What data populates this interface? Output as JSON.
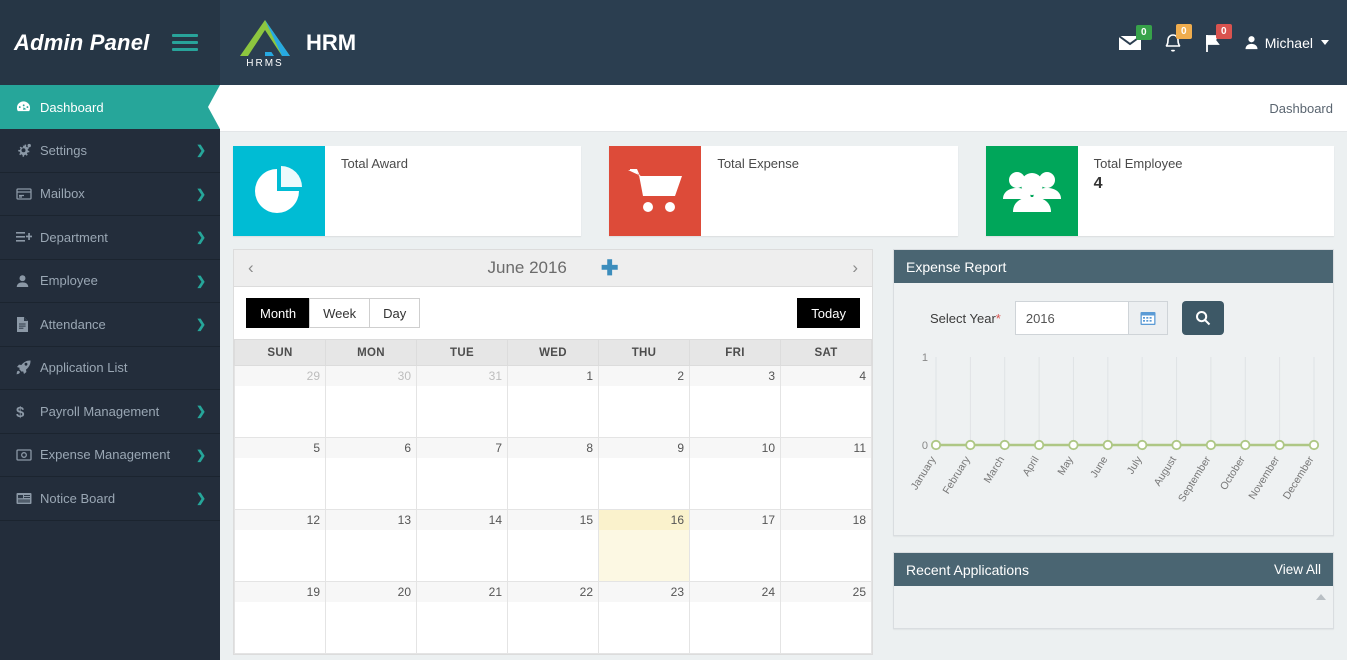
{
  "brand": {
    "title": "Admin Panel",
    "menu_icon": "hamburger-icon"
  },
  "header": {
    "logo_text": "HRMS",
    "app_title": "HRM",
    "notifications": [
      {
        "icon": "envelope-icon",
        "count": "0",
        "color": "#37a24a"
      },
      {
        "icon": "bell-icon",
        "count": "0",
        "color": "#f0ad4e"
      },
      {
        "icon": "flag-icon",
        "count": "0",
        "color": "#d9534f"
      }
    ],
    "user": "Michael"
  },
  "breadcrumb": {
    "current": "Dashboard"
  },
  "sidebar": {
    "items": [
      {
        "label": "Dashboard",
        "icon": "dashboard-icon",
        "active": true,
        "arrow": false
      },
      {
        "label": "Settings",
        "icon": "gears-icon",
        "active": false,
        "arrow": true
      },
      {
        "label": "Mailbox",
        "icon": "mailbox-icon",
        "active": false,
        "arrow": true
      },
      {
        "label": "Department",
        "icon": "department-icon",
        "active": false,
        "arrow": true
      },
      {
        "label": "Employee",
        "icon": "user-icon",
        "active": false,
        "arrow": true
      },
      {
        "label": "Attendance",
        "icon": "file-icon",
        "active": false,
        "arrow": true
      },
      {
        "label": "Application List",
        "icon": "rocket-icon",
        "active": false,
        "arrow": false
      },
      {
        "label": "Payroll Management",
        "icon": "dollar-icon",
        "active": false,
        "arrow": true
      },
      {
        "label": "Expense Management",
        "icon": "money-icon",
        "active": false,
        "arrow": true
      },
      {
        "label": "Notice Board",
        "icon": "board-icon",
        "active": false,
        "arrow": true
      }
    ]
  },
  "cards": [
    {
      "label": "Total Award",
      "value": "",
      "icon": "pie-chart-icon",
      "color": "#00bcd4"
    },
    {
      "label": "Total Expense",
      "value": "",
      "icon": "shopping-cart-icon",
      "color": "#dd4b39"
    },
    {
      "label": "Total Employee",
      "value": "4",
      "icon": "users-icon",
      "color": "#00a65a"
    }
  ],
  "calendar": {
    "title": "June 2016",
    "prev_icon": "chevron-left-icon",
    "next_icon": "chevron-right-icon",
    "add_icon": "plus-icon",
    "views": [
      {
        "label": "Month",
        "active": true
      },
      {
        "label": "Week",
        "active": false
      },
      {
        "label": "Day",
        "active": false
      }
    ],
    "today_label": "Today",
    "weekdays": [
      "SUN",
      "MON",
      "TUE",
      "WED",
      "THU",
      "FRI",
      "SAT"
    ],
    "weeks": [
      [
        {
          "day": "29",
          "other": true
        },
        {
          "day": "30",
          "other": true
        },
        {
          "day": "31",
          "other": true
        },
        {
          "day": "1",
          "other": false
        },
        {
          "day": "2",
          "other": false
        },
        {
          "day": "3",
          "other": false
        },
        {
          "day": "4",
          "other": false
        }
      ],
      [
        {
          "day": "5",
          "other": false
        },
        {
          "day": "6",
          "other": false
        },
        {
          "day": "7",
          "other": false
        },
        {
          "day": "8",
          "other": false
        },
        {
          "day": "9",
          "other": false
        },
        {
          "day": "10",
          "other": false
        },
        {
          "day": "11",
          "other": false
        }
      ],
      [
        {
          "day": "12",
          "other": false
        },
        {
          "day": "13",
          "other": false
        },
        {
          "day": "14",
          "other": false
        },
        {
          "day": "15",
          "other": false
        },
        {
          "day": "16",
          "other": false,
          "today": true
        },
        {
          "day": "17",
          "other": false
        },
        {
          "day": "18",
          "other": false
        }
      ],
      [
        {
          "day": "19",
          "other": false
        },
        {
          "day": "20",
          "other": false
        },
        {
          "day": "21",
          "other": false
        },
        {
          "day": "22",
          "other": false
        },
        {
          "day": "23",
          "other": false
        },
        {
          "day": "24",
          "other": false
        },
        {
          "day": "25",
          "other": false
        }
      ]
    ]
  },
  "expense_report": {
    "title": "Expense Report",
    "year_label": "Select Year",
    "required_mark": "*",
    "year_value": "2016",
    "calendar_icon": "calendar-icon",
    "search_icon": "search-icon"
  },
  "recent_applications": {
    "title": "Recent Applications",
    "view_all": "View All"
  },
  "chart_data": {
    "type": "line",
    "title": "Expense Report",
    "categories": [
      "January",
      "February",
      "March",
      "April",
      "May",
      "June",
      "July",
      "August",
      "September",
      "October",
      "November",
      "December"
    ],
    "values": [
      0,
      0,
      0,
      0,
      0,
      0,
      0,
      0,
      0,
      0,
      0,
      0
    ],
    "yticks": [
      "0",
      "1"
    ],
    "ylim": [
      0,
      1
    ],
    "xlabel": "",
    "ylabel": "",
    "grid": true,
    "legend": "none",
    "line_color": "#aec785",
    "marker_color": "#ffffff",
    "plot_bg": "#eef1f2"
  }
}
